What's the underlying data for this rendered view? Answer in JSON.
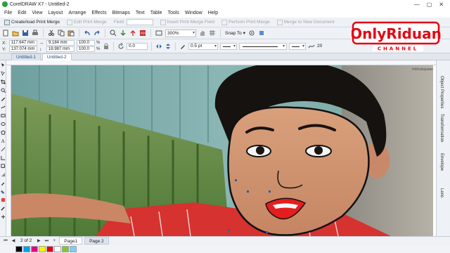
{
  "window": {
    "title": "CorelDRAW X7 - Untitled-2",
    "controls": [
      "—",
      "▢",
      "✕"
    ]
  },
  "menu": [
    "File",
    "Edit",
    "View",
    "Layout",
    "Arrange",
    "Effects",
    "Bitmaps",
    "Text",
    "Table",
    "Tools",
    "Window",
    "Help"
  ],
  "merge_toolbar": {
    "create_load": "Create/load Print Merge",
    "edit": "Edit Print Merge",
    "field_label": "Field:",
    "insert_field": "Insert Print Merge Field",
    "perform": "Perform Print Merge",
    "merge_new": "Merge to New Document"
  },
  "standard_toolbar": {
    "zoom": "300%",
    "snap_to": "Snap To"
  },
  "property_bar": {
    "x": "117.647 mm",
    "y": "137.074 mm",
    "width": "9.184 mm",
    "height": "18.987 mm",
    "scale_x": "100.0",
    "scale_y": "100.0",
    "pct_x": "%",
    "pct_y": "%",
    "rotation": "0.0",
    "outline_width": "0.5 pt",
    "nib": "20"
  },
  "doc_tabs": [
    "Untitled-1",
    "Untitled-2"
  ],
  "dockers": [
    "Object Properties",
    "Transformation",
    "Envelope",
    "Lens"
  ],
  "pages": {
    "count": "2 of 2",
    "tabs": [
      "Page1",
      "Page 2"
    ]
  },
  "palette": [
    "#000000",
    "#00a0e9",
    "#e4007f",
    "#fff100",
    "#e60012",
    "#ffffff",
    "#8fc31f",
    "#7ecef4"
  ],
  "logo": {
    "name": "OnlyRiduan",
    "tagline": "CHANNEL",
    "color": "#e30613"
  },
  "canvas_label": "mttratqueen"
}
